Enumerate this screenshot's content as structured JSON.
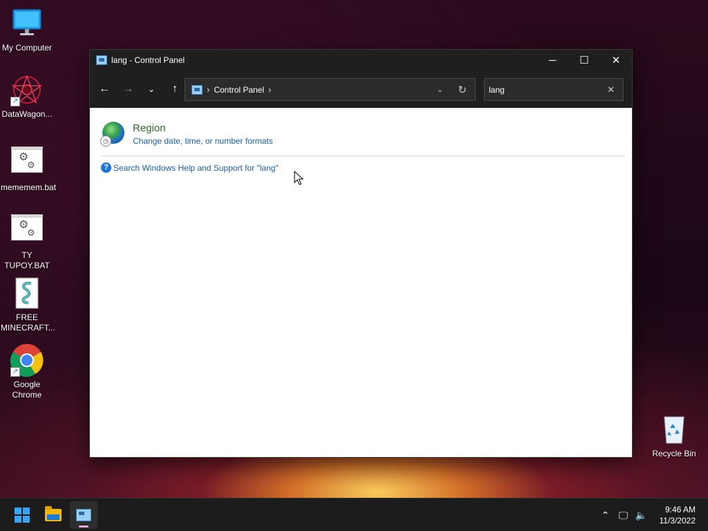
{
  "desktop": {
    "icons": [
      {
        "label": "My Computer"
      },
      {
        "label": "DataWagon..."
      },
      {
        "label": "mememem.bat"
      },
      {
        "label": "TY\nTUPOY.BAT"
      },
      {
        "label": "FREE\nMINECRAFT..."
      },
      {
        "label": "Google\nChrome"
      },
      {
        "label": "Recycle Bin"
      }
    ]
  },
  "window": {
    "title": "lang - Control Panel",
    "address": {
      "segments": [
        "Control Panel"
      ]
    },
    "search": {
      "value": "lang"
    },
    "results": [
      {
        "title": "Region",
        "subtitle": "Change date, time, or number formats"
      }
    ],
    "help_link": "Search Windows Help and Support for \"lang\""
  },
  "taskbar": {
    "time": "9:46 AM",
    "date": "11/3/2022",
    "icons": [
      "start-icon",
      "file-explorer-icon",
      "control-panel-icon"
    ]
  },
  "colors": {
    "accent": "#1a5fb4",
    "result_title": "#2a6e2a",
    "taskbar": "#1c1c1c"
  }
}
